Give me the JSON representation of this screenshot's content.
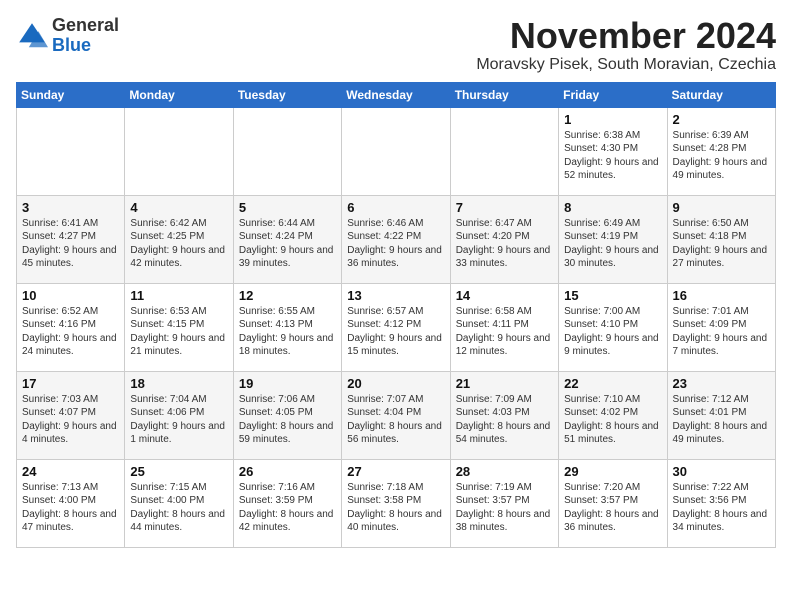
{
  "logo": {
    "general": "General",
    "blue": "Blue"
  },
  "title": "November 2024",
  "subtitle": "Moravsky Pisek, South Moravian, Czechia",
  "header": {
    "days": [
      "Sunday",
      "Monday",
      "Tuesday",
      "Wednesday",
      "Thursday",
      "Friday",
      "Saturday"
    ]
  },
  "weeks": [
    [
      {
        "day": "",
        "info": ""
      },
      {
        "day": "",
        "info": ""
      },
      {
        "day": "",
        "info": ""
      },
      {
        "day": "",
        "info": ""
      },
      {
        "day": "",
        "info": ""
      },
      {
        "day": "1",
        "info": "Sunrise: 6:38 AM\nSunset: 4:30 PM\nDaylight: 9 hours\nand 52 minutes."
      },
      {
        "day": "2",
        "info": "Sunrise: 6:39 AM\nSunset: 4:28 PM\nDaylight: 9 hours\nand 49 minutes."
      }
    ],
    [
      {
        "day": "3",
        "info": "Sunrise: 6:41 AM\nSunset: 4:27 PM\nDaylight: 9 hours\nand 45 minutes."
      },
      {
        "day": "4",
        "info": "Sunrise: 6:42 AM\nSunset: 4:25 PM\nDaylight: 9 hours\nand 42 minutes."
      },
      {
        "day": "5",
        "info": "Sunrise: 6:44 AM\nSunset: 4:24 PM\nDaylight: 9 hours\nand 39 minutes."
      },
      {
        "day": "6",
        "info": "Sunrise: 6:46 AM\nSunset: 4:22 PM\nDaylight: 9 hours\nand 36 minutes."
      },
      {
        "day": "7",
        "info": "Sunrise: 6:47 AM\nSunset: 4:20 PM\nDaylight: 9 hours\nand 33 minutes."
      },
      {
        "day": "8",
        "info": "Sunrise: 6:49 AM\nSunset: 4:19 PM\nDaylight: 9 hours\nand 30 minutes."
      },
      {
        "day": "9",
        "info": "Sunrise: 6:50 AM\nSunset: 4:18 PM\nDaylight: 9 hours\nand 27 minutes."
      }
    ],
    [
      {
        "day": "10",
        "info": "Sunrise: 6:52 AM\nSunset: 4:16 PM\nDaylight: 9 hours\nand 24 minutes."
      },
      {
        "day": "11",
        "info": "Sunrise: 6:53 AM\nSunset: 4:15 PM\nDaylight: 9 hours\nand 21 minutes."
      },
      {
        "day": "12",
        "info": "Sunrise: 6:55 AM\nSunset: 4:13 PM\nDaylight: 9 hours\nand 18 minutes."
      },
      {
        "day": "13",
        "info": "Sunrise: 6:57 AM\nSunset: 4:12 PM\nDaylight: 9 hours\nand 15 minutes."
      },
      {
        "day": "14",
        "info": "Sunrise: 6:58 AM\nSunset: 4:11 PM\nDaylight: 9 hours\nand 12 minutes."
      },
      {
        "day": "15",
        "info": "Sunrise: 7:00 AM\nSunset: 4:10 PM\nDaylight: 9 hours\nand 9 minutes."
      },
      {
        "day": "16",
        "info": "Sunrise: 7:01 AM\nSunset: 4:09 PM\nDaylight: 9 hours\nand 7 minutes."
      }
    ],
    [
      {
        "day": "17",
        "info": "Sunrise: 7:03 AM\nSunset: 4:07 PM\nDaylight: 9 hours\nand 4 minutes."
      },
      {
        "day": "18",
        "info": "Sunrise: 7:04 AM\nSunset: 4:06 PM\nDaylight: 9 hours\nand 1 minute."
      },
      {
        "day": "19",
        "info": "Sunrise: 7:06 AM\nSunset: 4:05 PM\nDaylight: 8 hours\nand 59 minutes."
      },
      {
        "day": "20",
        "info": "Sunrise: 7:07 AM\nSunset: 4:04 PM\nDaylight: 8 hours\nand 56 minutes."
      },
      {
        "day": "21",
        "info": "Sunrise: 7:09 AM\nSunset: 4:03 PM\nDaylight: 8 hours\nand 54 minutes."
      },
      {
        "day": "22",
        "info": "Sunrise: 7:10 AM\nSunset: 4:02 PM\nDaylight: 8 hours\nand 51 minutes."
      },
      {
        "day": "23",
        "info": "Sunrise: 7:12 AM\nSunset: 4:01 PM\nDaylight: 8 hours\nand 49 minutes."
      }
    ],
    [
      {
        "day": "24",
        "info": "Sunrise: 7:13 AM\nSunset: 4:00 PM\nDaylight: 8 hours\nand 47 minutes."
      },
      {
        "day": "25",
        "info": "Sunrise: 7:15 AM\nSunset: 4:00 PM\nDaylight: 8 hours\nand 44 minutes."
      },
      {
        "day": "26",
        "info": "Sunrise: 7:16 AM\nSunset: 3:59 PM\nDaylight: 8 hours\nand 42 minutes."
      },
      {
        "day": "27",
        "info": "Sunrise: 7:18 AM\nSunset: 3:58 PM\nDaylight: 8 hours\nand 40 minutes."
      },
      {
        "day": "28",
        "info": "Sunrise: 7:19 AM\nSunset: 3:57 PM\nDaylight: 8 hours\nand 38 minutes."
      },
      {
        "day": "29",
        "info": "Sunrise: 7:20 AM\nSunset: 3:57 PM\nDaylight: 8 hours\nand 36 minutes."
      },
      {
        "day": "30",
        "info": "Sunrise: 7:22 AM\nSunset: 3:56 PM\nDaylight: 8 hours\nand 34 minutes."
      }
    ]
  ]
}
